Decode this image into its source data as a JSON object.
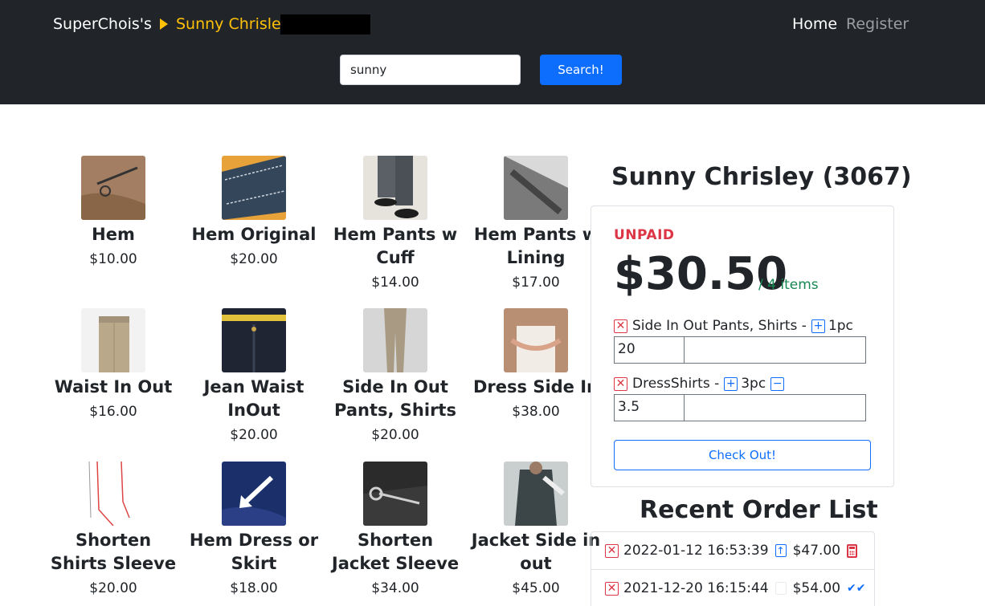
{
  "header": {
    "brand": "SuperChois's",
    "customer_crumb": "Sunny Chrisley",
    "crumb_suffix": ")",
    "nav": {
      "home": "Home",
      "register": "Register"
    },
    "search": {
      "value": "sunny",
      "button": "Search!"
    }
  },
  "products": [
    {
      "name": "Hem",
      "price": "$10.00"
    },
    {
      "name": "Hem Original",
      "price": "$20.00"
    },
    {
      "name": "Hem Pants w Cuff",
      "price": "$14.00"
    },
    {
      "name": "Hem Pants w Lining",
      "price": "$17.00"
    },
    {
      "name": "Waist In Out",
      "price": "$16.00"
    },
    {
      "name": "Jean Waist InOut",
      "price": "$20.00"
    },
    {
      "name": "Side In Out Pants, Shirts",
      "price": "$20.00"
    },
    {
      "name": "Dress Side In",
      "price": "$38.00"
    },
    {
      "name": "Shorten Shirts Sleeve",
      "price": "$20.00"
    },
    {
      "name": "Hem Dress or Skirt",
      "price": "$18.00"
    },
    {
      "name": "Shorten Jacket Sleeve",
      "price": "$34.00"
    },
    {
      "name": "Jacket Side in out",
      "price": "$45.00"
    }
  ],
  "order": {
    "customer_title": "Sunny Chrisley (3067)",
    "status": "UNPAID",
    "total": "$30.50",
    "items_count": "/ 4 items",
    "lines": [
      {
        "name": "Side In Out Pants, Shirts -",
        "qty": "1pc",
        "price_value": "20"
      },
      {
        "name": "DressShirts -",
        "qty": "3pc",
        "price_value": "3.5"
      }
    ],
    "checkout": "Check Out!"
  },
  "recent": {
    "title": "Recent Order List",
    "orders": [
      {
        "timestamp": "2022-01-12 16:53:39",
        "amount": "$47.00"
      },
      {
        "timestamp": "2021-12-20 16:15:44",
        "amount": "$54.00"
      }
    ]
  },
  "colors": {
    "navbar": "#212529",
    "crumb": "#ffc107",
    "primary": "#0d6efd",
    "danger": "#dc3545",
    "success": "#198754"
  }
}
